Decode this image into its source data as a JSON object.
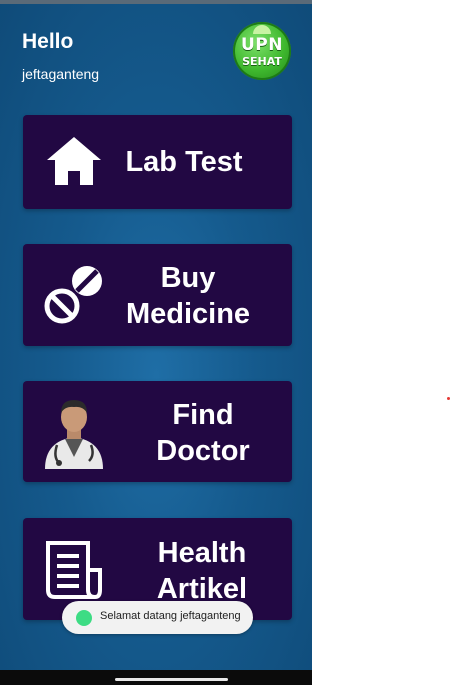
{
  "header": {
    "greeting": "Hello",
    "username": "jeftaganteng",
    "logo_line1": "UPN",
    "logo_line2": "SEHAT"
  },
  "menu": [
    {
      "label": "Lab Test",
      "icon": "home-icon"
    },
    {
      "label": "Buy Medicine",
      "icon": "pill-icon"
    },
    {
      "label": "Find Doctor",
      "icon": "doctor-icon"
    },
    {
      "label": "Health Artikel",
      "icon": "article-icon"
    }
  ],
  "toast": {
    "text": "Selamat datang jeftaganteng",
    "icon": "android-icon"
  },
  "colors": {
    "background": "#155a8d",
    "card": "#220843",
    "text": "#ffffff",
    "logo": "#3fb82e"
  }
}
